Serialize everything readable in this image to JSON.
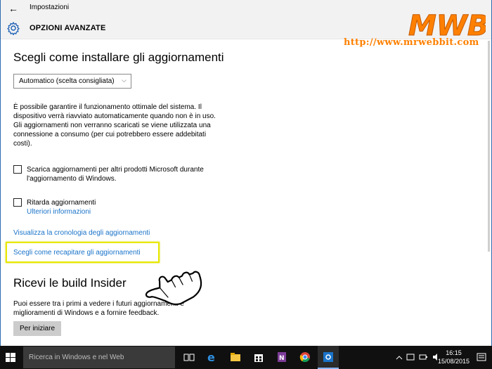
{
  "window": {
    "title": "Impostazioni",
    "back_glyph": "←"
  },
  "header": {
    "title": "OPZIONI AVANZATE"
  },
  "watermark": {
    "logo_text": "MWB",
    "url": "http://www.mrwebbit.com"
  },
  "updates": {
    "heading": "Scegli come installare gli aggiornamenti",
    "select_value": "Automatico (scelta consigliata)",
    "description": "È possibile garantire il funzionamento ottimale del sistema. Il dispositivo verrà riavviato automaticamente quando non è in uso. Gli aggiornamenti non verranno scaricati se viene utilizzata una connessione a consumo (per cui potrebbero essere addebitati costi).",
    "checkbox1_label": "Scarica aggiornamenti per altri prodotti Microsoft durante l'aggiornamento di Windows.",
    "checkbox1_checked": false,
    "checkbox2_label": "Ritarda aggiornamenti",
    "checkbox2_checked": false,
    "more_info_link": "Ulteriori informazioni",
    "history_link": "Visualizza la cronologia degli aggiornamenti",
    "delivery_link": "Scegli come recapitare gli aggiornamenti"
  },
  "insider": {
    "heading": "Ricevi le build Insider",
    "description": "Puoi essere tra i primi a vedere i futuri aggiornamenti e miglioramenti di Windows e a fornire feedback.",
    "button_label": "Per iniziare"
  },
  "taskbar": {
    "search_placeholder": "Ricerca in Windows e nel Web",
    "time": "16:15",
    "date": "15/08/2015",
    "icons": [
      "task-view-icon",
      "edge-icon",
      "file-explorer-icon",
      "store-icon",
      "onenote-icon",
      "chrome-icon",
      "settings-icon"
    ]
  },
  "colors": {
    "link": "#1a73c9",
    "highlight": "#e8e800",
    "watermark": "#ff8000",
    "taskbar": "#101010"
  }
}
